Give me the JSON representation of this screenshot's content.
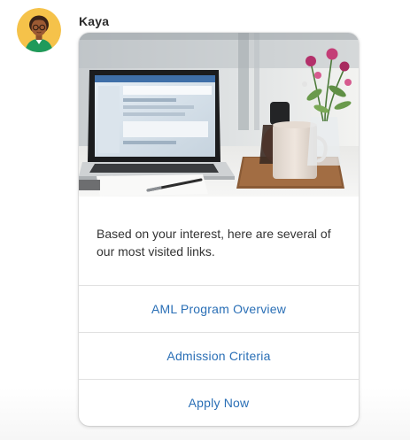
{
  "chat": {
    "sender_name": "Kaya",
    "avatar_icon": "avatar-kaya-icon",
    "card": {
      "image_icon": "laptop-desk-photo",
      "message": "Based on your interest, here are several of our most visited links.",
      "links": [
        {
          "label": "AML Program Overview"
        },
        {
          "label": "Admission Criteria"
        },
        {
          "label": "Apply Now"
        }
      ]
    }
  },
  "colors": {
    "link": "#2a6fb6",
    "avatar_background": "#f5c24a"
  }
}
